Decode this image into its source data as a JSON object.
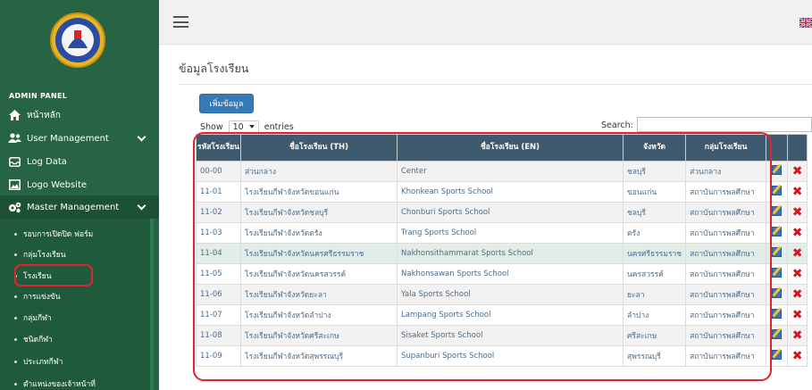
{
  "sidebar": {
    "title": "ADMIN PANEL",
    "items": [
      {
        "label": "หน้าหลัก",
        "icon": "home-icon"
      },
      {
        "label": "User Management",
        "icon": "users-icon"
      },
      {
        "label": "Log Data",
        "icon": "inbox-icon"
      },
      {
        "label": "Logo Website",
        "icon": "image-icon"
      },
      {
        "label": "Master Management",
        "icon": "cogs-icon"
      }
    ],
    "sub_items": [
      "รอบการเปิดปิด ฟอร์ม",
      "กลุ่มโรงเรียน",
      "โรงเรียน",
      "การแข่งขัน",
      "กลุ่มกีฬา",
      "ชนิดกีฬา",
      "ประเภทกีฬา",
      "ตำแหน่งของเจ้าหน้าที่"
    ],
    "active_sub": "โรงเรียน"
  },
  "header": {
    "menu_icon": "hamburger-icon",
    "flag_icon": "uk-flag-icon"
  },
  "main": {
    "page_title": "ข้อมูลโรงเรียน",
    "add_button": "เพิ่มข้อมูล",
    "show_label": "Show",
    "page_length": "10",
    "entries_label": "entries",
    "search_label": "Search:",
    "search_value": ""
  },
  "table": {
    "columns": [
      "รหัสโรงเรียน",
      "ชื่อโรงเรียน (TH)",
      "ชื่อโรงเรียน (EN)",
      "จังหวัด",
      "กลุ่มโรงเรียน"
    ],
    "rows": [
      {
        "code": "00-00",
        "name_th": "ส่วนกลาง",
        "name_en": "Center",
        "province": "ชลบุรี",
        "group": "ส่วนกลาง"
      },
      {
        "code": "11-01",
        "name_th": "โรงเรียนกีฬาจังหวัดขอนแก่น",
        "name_en": "Khonkean Sports School",
        "province": "ขอนแก่น",
        "group": "สถาบันการพลศึกษา"
      },
      {
        "code": "11-02",
        "name_th": "โรงเรียนกีฬาจังหวัดชลบุรี",
        "name_en": "Chonburi Sports School",
        "province": "ชลบุรี",
        "group": "สถาบันการพลศึกษา"
      },
      {
        "code": "11-03",
        "name_th": "โรงเรียนกีฬาจังหวัดตรัง",
        "name_en": "Trang Sports School",
        "province": "ตรัง",
        "group": "สถาบันการพลศึกษา"
      },
      {
        "code": "11-04",
        "name_th": "โรงเรียนกีฬาจังหวัดนครศรีธรรมราช",
        "name_en": "Nakhonsithammarat Sports School",
        "province": "นครศรีธรรมราช",
        "group": "สถาบันการพลศึกษา"
      },
      {
        "code": "11-05",
        "name_th": "โรงเรียนกีฬาจังหวัดนครสวรรค์",
        "name_en": "Nakhonsawan Sports School",
        "province": "นครสวรรค์",
        "group": "สถาบันการพลศึกษา"
      },
      {
        "code": "11-06",
        "name_th": "โรงเรียนกีฬาจังหวัดยะลา",
        "name_en": "Yala Sports School",
        "province": "ยะลา",
        "group": "สถาบันการพลศึกษา"
      },
      {
        "code": "11-07",
        "name_th": "โรงเรียนกีฬาจังหวัดลำปาง",
        "name_en": "Lampang Sports School",
        "province": "ลำปาง",
        "group": "สถาบันการพลศึกษา"
      },
      {
        "code": "11-08",
        "name_th": "โรงเรียนกีฬาจังหวัดศรีสะเกษ",
        "name_en": "Sisaket Sports School",
        "province": "ศรีสะเกษ",
        "group": "สถาบันการพลศึกษา"
      },
      {
        "code": "11-09",
        "name_th": "โรงเรียนกีฬาจังหวัดสุพรรณบุรี",
        "name_en": "Supanburi Sports School",
        "province": "สุพรรณบุรี",
        "group": "สถาบันการพลศึกษา"
      }
    ]
  },
  "colors": {
    "sidebar_bg": "#266444",
    "table_header_bg": "#3d5a6e",
    "primary_button": "#337ab7",
    "highlight_border": "#e0232f"
  }
}
